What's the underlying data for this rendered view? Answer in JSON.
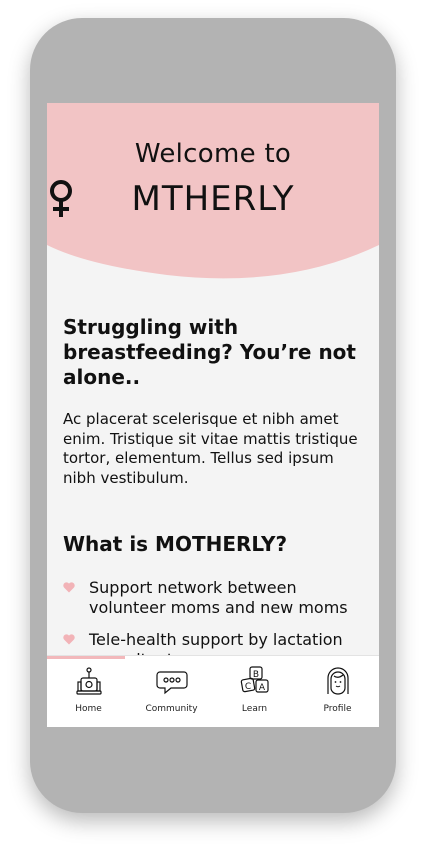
{
  "hero": {
    "welcome": "Welcome to",
    "brand_left": "M",
    "brand_right": "THERLY",
    "background_color": "#f2c4c5"
  },
  "content": {
    "heading": "Struggling with breastfeeding? You’re not alone..",
    "paragraph": "Ac placerat scelerisque et nibh amet enim. Tristique sit vitae mattis tristique tortor, elementum. Tellus sed ipsum nibh vestibulum.",
    "what_heading": "What is MOTHERLY?",
    "list": [
      "Support network between volunteer moms and new moms",
      "Tele-health support by lactation consultants"
    ]
  },
  "tabs": [
    {
      "label": "Home",
      "icon": "home-icon"
    },
    {
      "label": "Community",
      "icon": "community-icon"
    },
    {
      "label": "Learn",
      "icon": "learn-icon"
    },
    {
      "label": "Profile",
      "icon": "profile-icon"
    }
  ],
  "colors": {
    "accent": "#f2b8bb",
    "heart": "#f2b3b7",
    "screen_bg": "#f4f4f4",
    "phone": "#b3b3b3"
  }
}
